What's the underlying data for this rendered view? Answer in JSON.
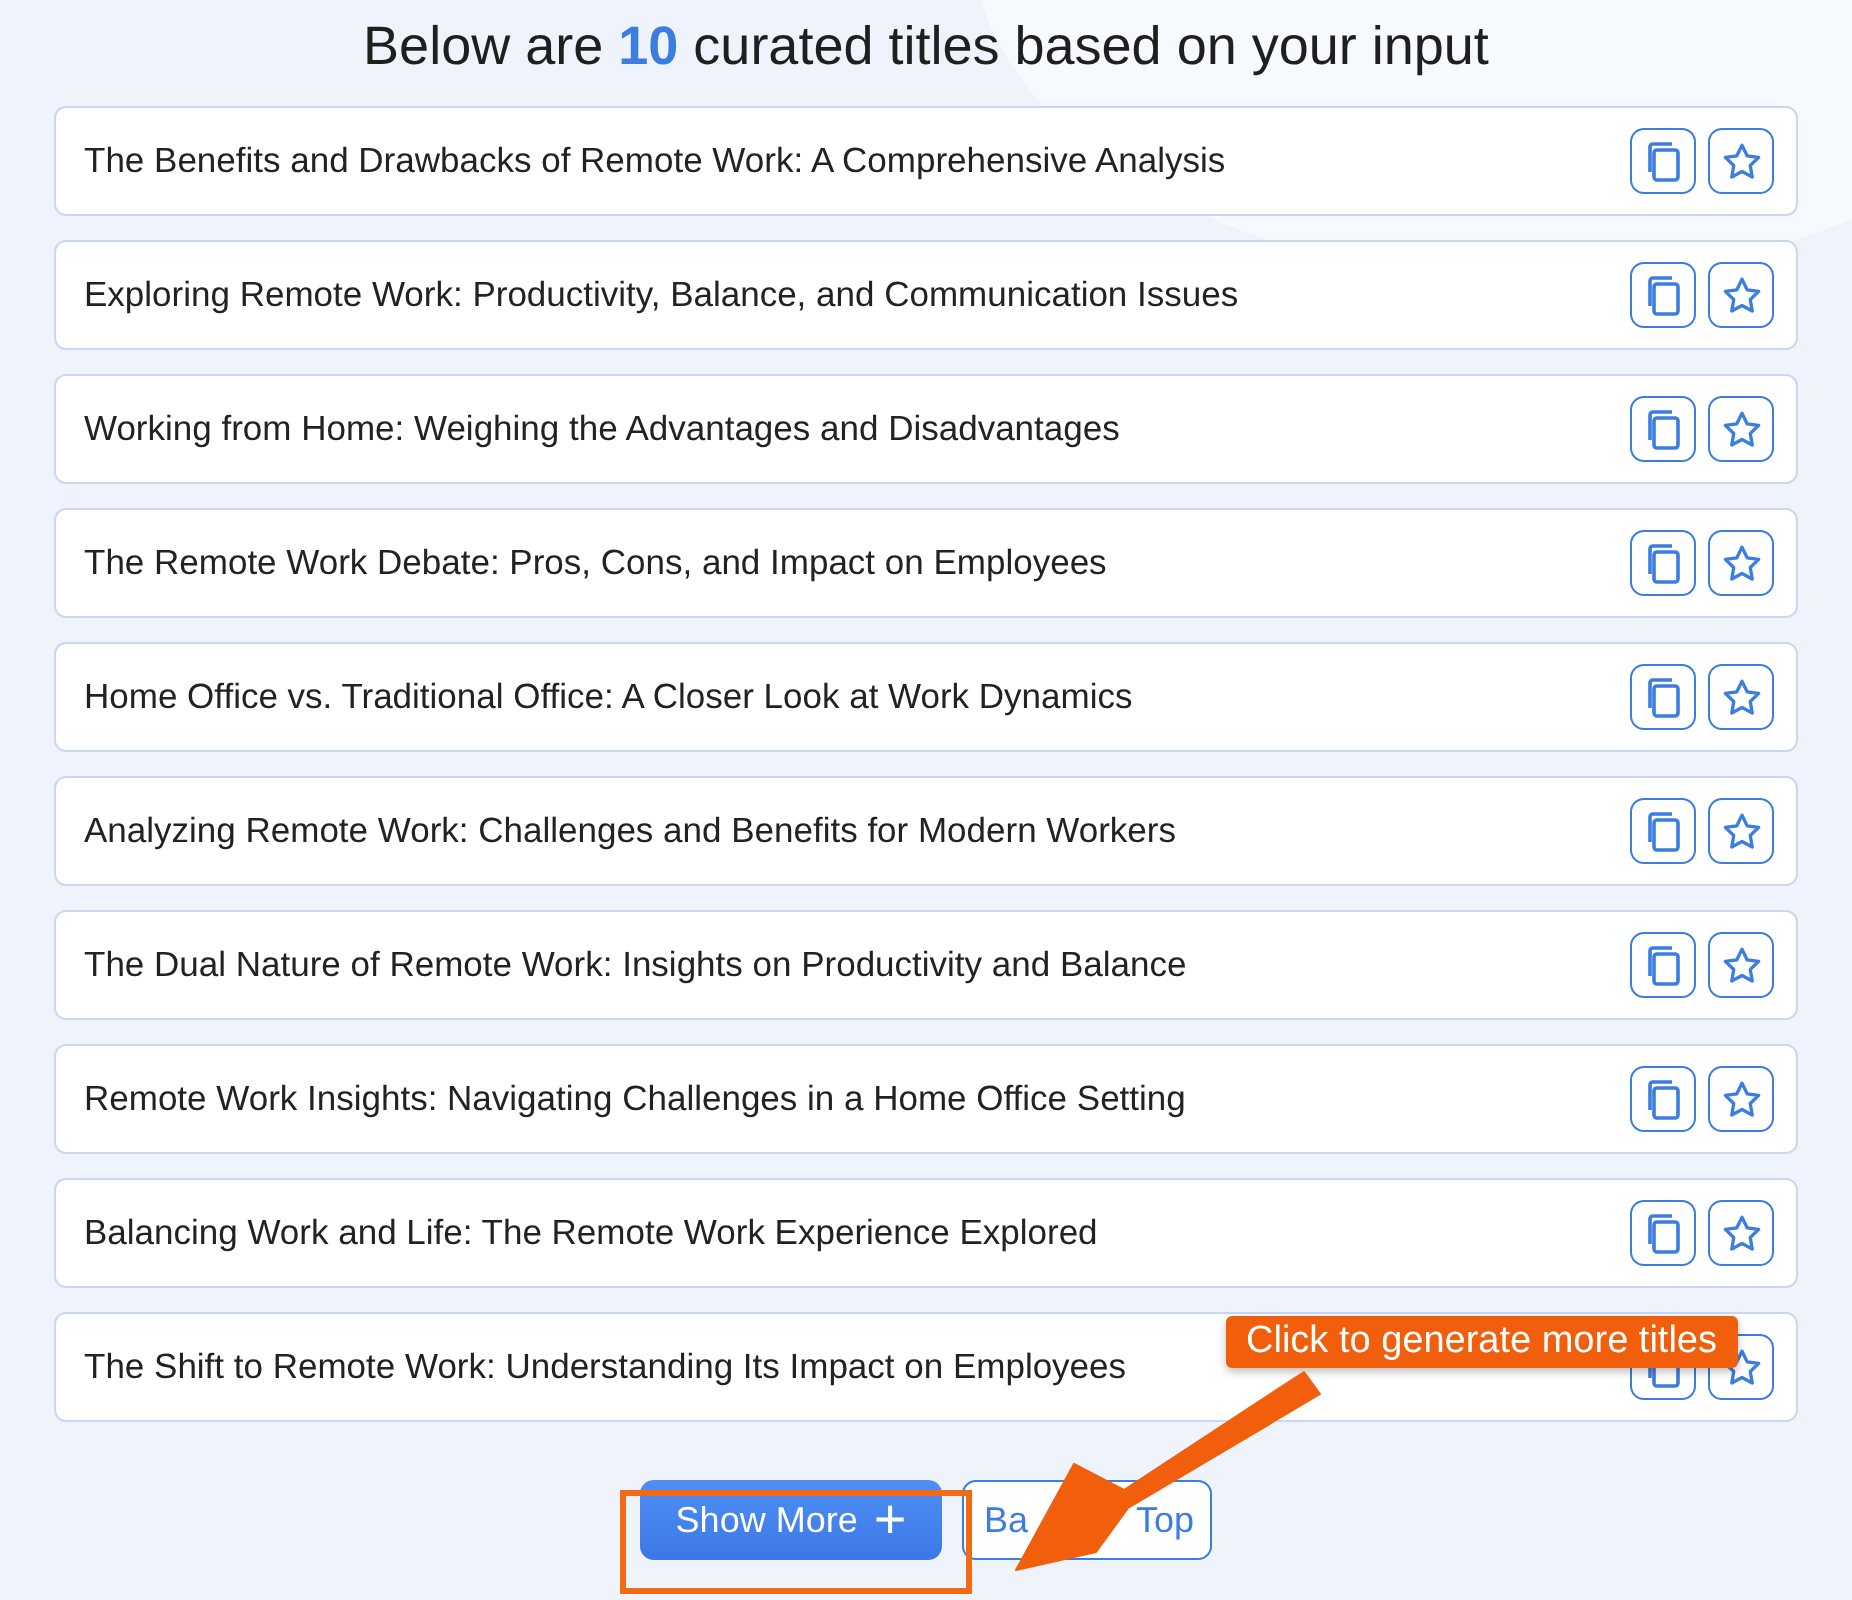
{
  "heading": "Below are **10** curated titles based on your input",
  "titles": [
    {
      "text": "The Benefits and Drawbacks of Remote Work: A Comprehensive Analysis"
    },
    {
      "text": "Exploring Remote Work: Productivity, Balance, and Communication Issues"
    },
    {
      "text": "Working from Home: Weighing the Advantages and Disadvantages"
    },
    {
      "text": "The Remote Work Debate: Pros, Cons, and Impact on Employees"
    },
    {
      "text": "Home Office vs. Traditional Office: A Closer Look at Work Dynamics"
    },
    {
      "text": "Analyzing Remote Work: Challenges and Benefits for Modern Workers"
    },
    {
      "text": "The Dual Nature of Remote Work: Insights on Productivity and Balance"
    },
    {
      "text": "Remote Work Insights: Navigating Challenges in a Home Office Setting"
    },
    {
      "text": "Balancing Work and Life: The Remote Work Experience Explored"
    },
    {
      "text": "The Shift to Remote Work: Understanding Its Impact on Employees"
    }
  ],
  "show_more_button": {
    "label": "Show More",
    "icon": "+"
  },
  "back_to_top_button": {
    "visible_parts": [
      "Ba",
      "Top"
    ]
  },
  "annotation": {
    "callout": "Click to generate more titles"
  }
}
